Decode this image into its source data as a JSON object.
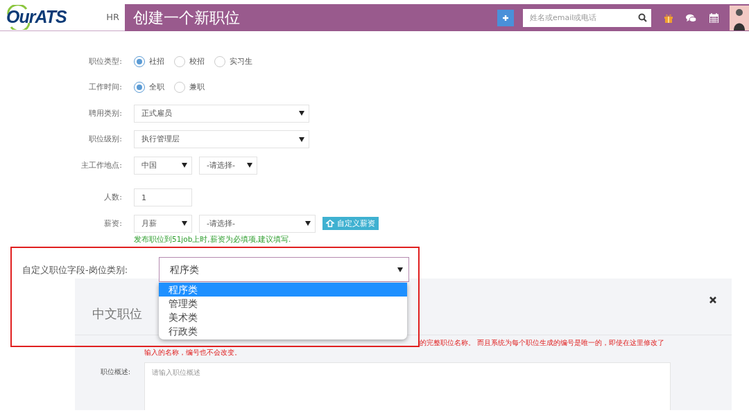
{
  "header": {
    "logo": "OurATS",
    "section": "HR",
    "title": "创建一个新职位",
    "search": {
      "placeholder": "姓名或email或电话"
    }
  },
  "form": [
    {
      "kind": "radio",
      "label": "职位类型:",
      "options": [
        {
          "label": "社招",
          "selected": true
        },
        {
          "label": "校招",
          "selected": false
        },
        {
          "label": "实习生",
          "selected": false
        }
      ]
    },
    {
      "kind": "radio",
      "label": "工作时间:",
      "options": [
        {
          "label": "全职",
          "selected": true
        },
        {
          "label": "兼职",
          "selected": false
        }
      ]
    },
    {
      "kind": "select",
      "label": "聘用类别:",
      "selects": [
        {
          "value": "正式雇员"
        }
      ]
    },
    {
      "kind": "select",
      "label": "职位级别:",
      "selects": [
        {
          "value": "执行管理层"
        }
      ]
    },
    {
      "kind": "select",
      "label": "主工作地点:",
      "selects": [
        {
          "value": "中国"
        },
        {
          "value": "-请选择-"
        }
      ]
    },
    {
      "kind": "input",
      "label": "人数:",
      "value": "1"
    },
    {
      "kind": "select",
      "label": "薪资:",
      "selects": [
        {
          "value": "月薪"
        },
        {
          "value": "-请选择-"
        }
      ],
      "button": "自定义薪资"
    }
  ],
  "salary_note": "发布职位到51job上时,薪资为必填项,建议填写.",
  "custom_field": {
    "label": "自定义职位字段-岗位类别:",
    "value": "程序类",
    "expanded": true,
    "options": [
      {
        "label": "程序类",
        "selected": true
      },
      {
        "label": "管理类",
        "selected": false
      },
      {
        "label": "美术类",
        "selected": false
      },
      {
        "label": "行政类",
        "selected": false
      }
    ]
  },
  "panel": {
    "title": "中文职位",
    "notice_lines": [
      "的完整职位名称。 而且系统为每个职位生成的编号是唯一的，即使在这里修改了",
      "输入的名称，编号也不会改变。"
    ],
    "summary": {
      "label": "职位概述:",
      "placeholder": "请输入职位概述"
    }
  }
}
